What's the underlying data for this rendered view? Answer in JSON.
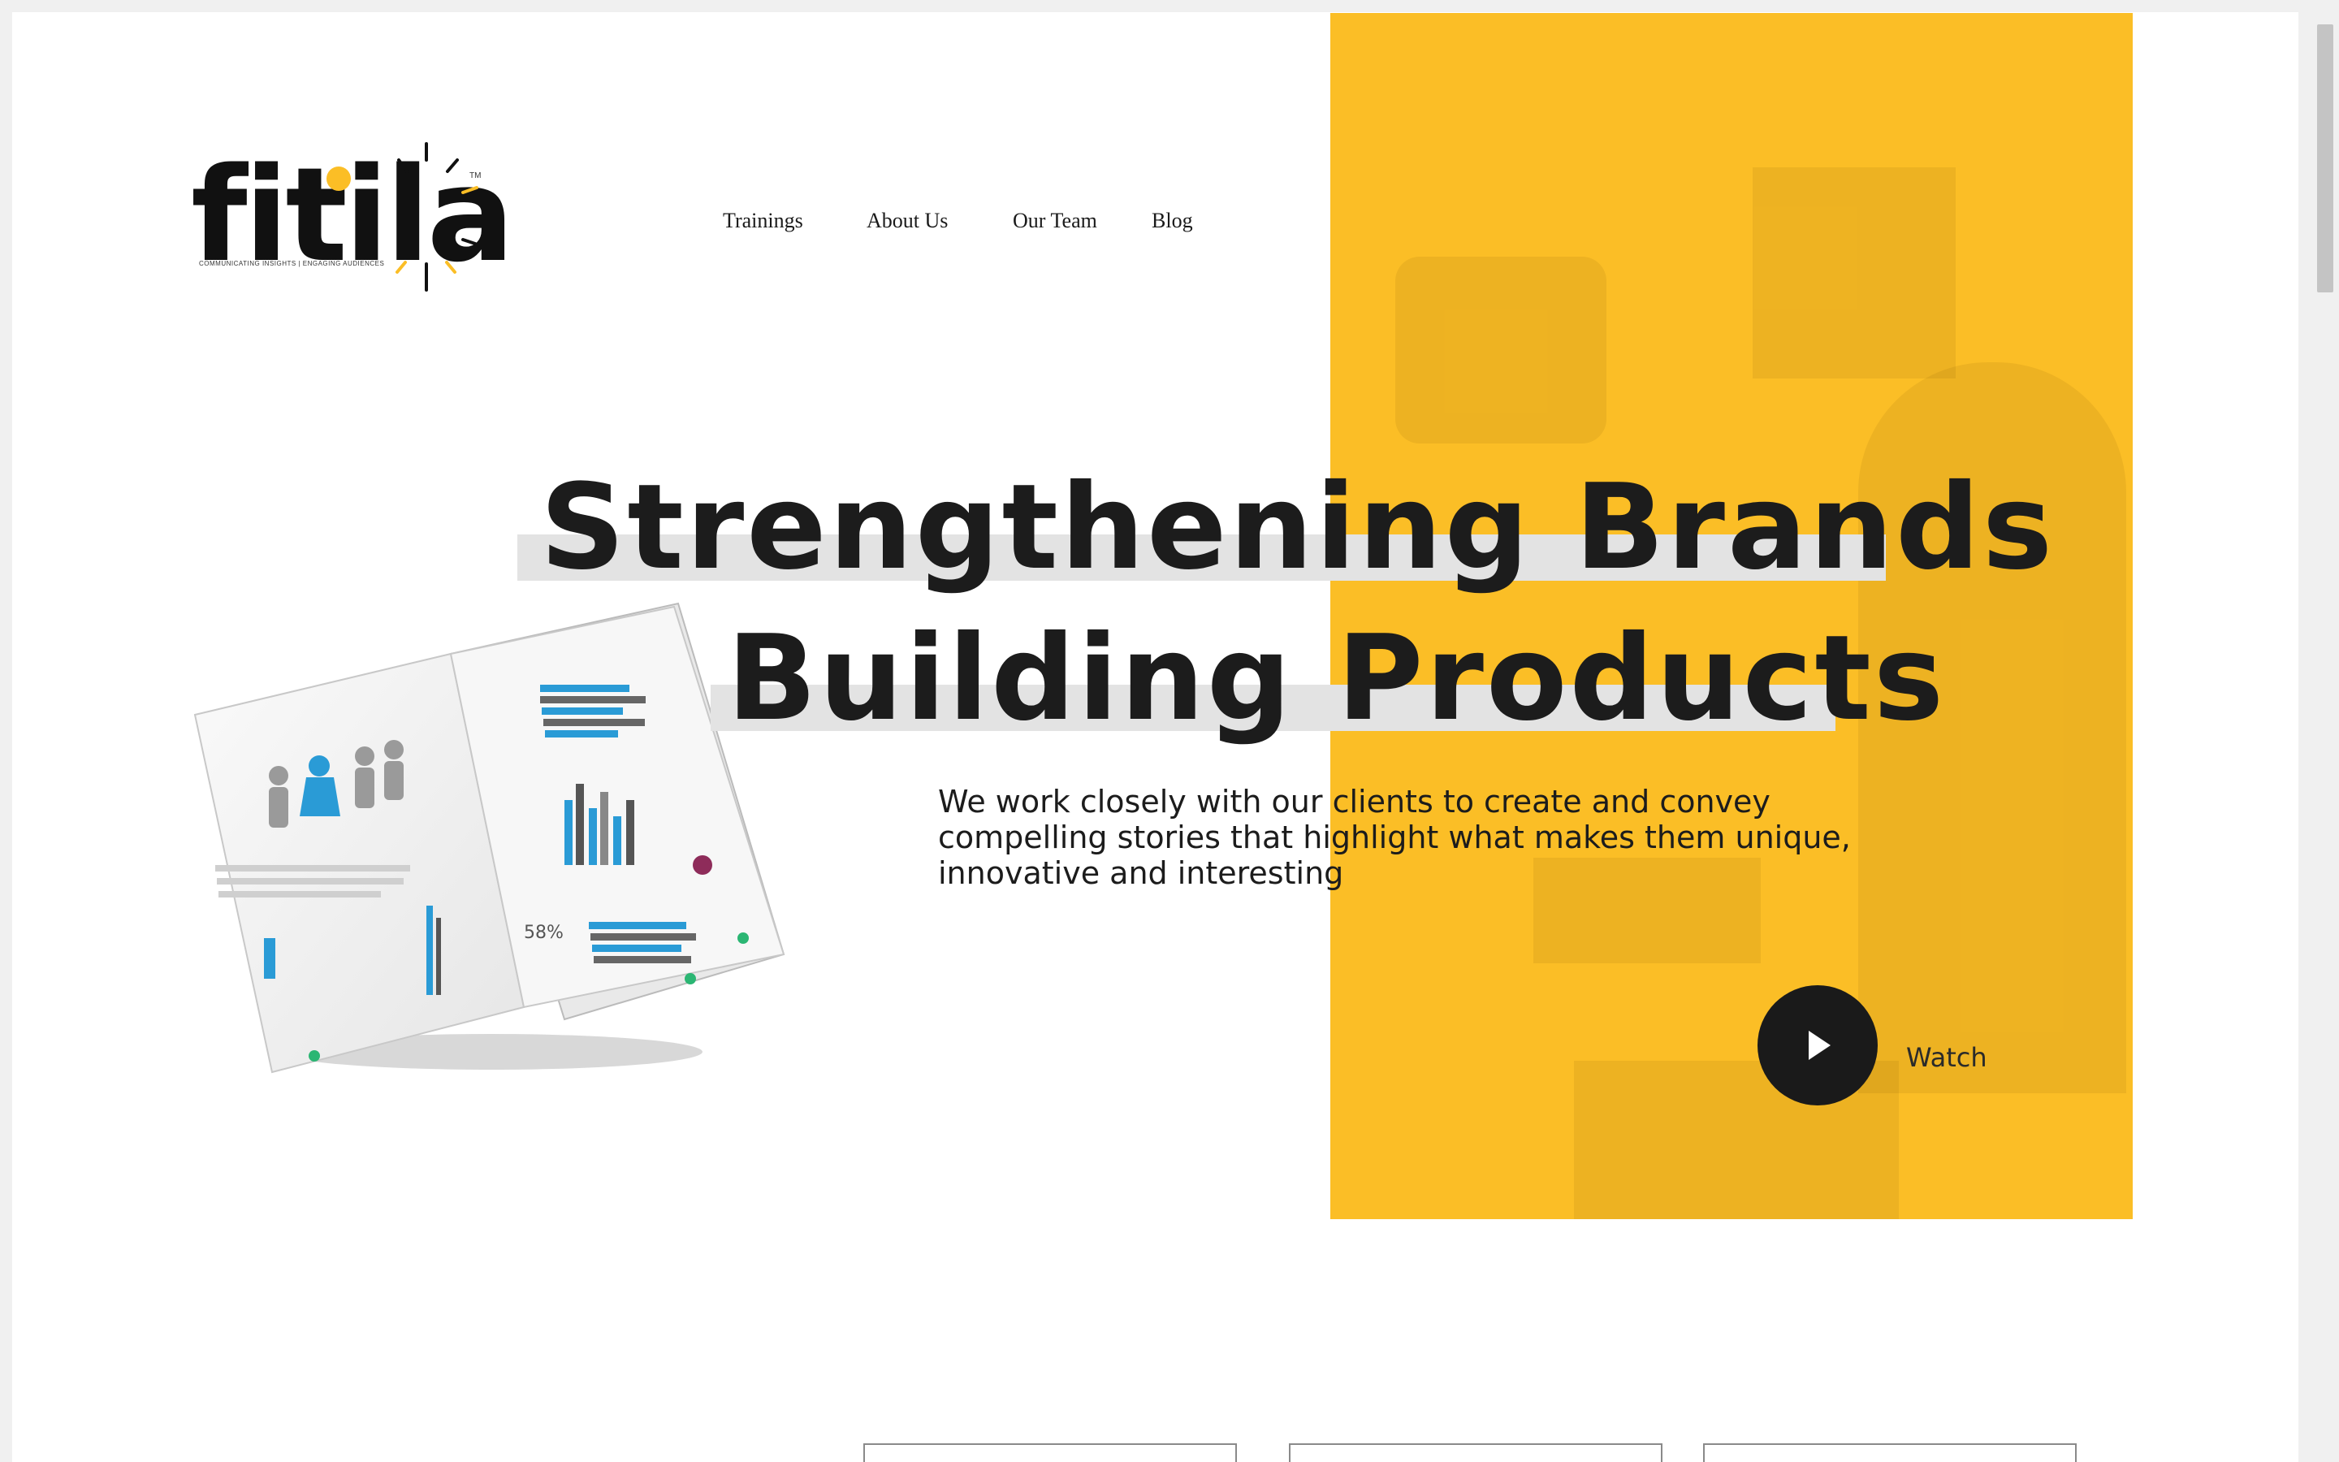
{
  "brand": {
    "logo_text": "fitila",
    "tagline": "COMMUNICATING INSIGHTS | ENGAGING AUDIENCES",
    "trademark": "TM"
  },
  "nav": {
    "items": [
      {
        "label": "Trainings"
      },
      {
        "label": "About Us"
      },
      {
        "label": "Our Team"
      },
      {
        "label": "Blog"
      }
    ]
  },
  "hero": {
    "headline_line1": "Strengthening Brands",
    "headline_line2": "Building Products",
    "subtext": "We work closely with our clients to create and convey compelling stories that highlight what makes them unique, innovative and interesting",
    "watch_label": "Watch",
    "accent_color": "#fbbe26"
  },
  "icons": {
    "play": "play-icon",
    "logo": "fitila-lamp-logo"
  }
}
